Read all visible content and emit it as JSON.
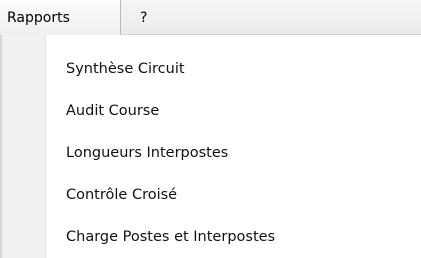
{
  "menubar": {
    "items": [
      {
        "label": "Rapports"
      },
      {
        "label": "?"
      }
    ]
  },
  "dropdown": {
    "items": [
      {
        "label": "Synthèse Circuit"
      },
      {
        "label": "Audit Course"
      },
      {
        "label": "Longueurs Interpostes"
      },
      {
        "label": "Contrôle Croisé"
      },
      {
        "label": "Charge Postes et Interpostes"
      }
    ]
  }
}
